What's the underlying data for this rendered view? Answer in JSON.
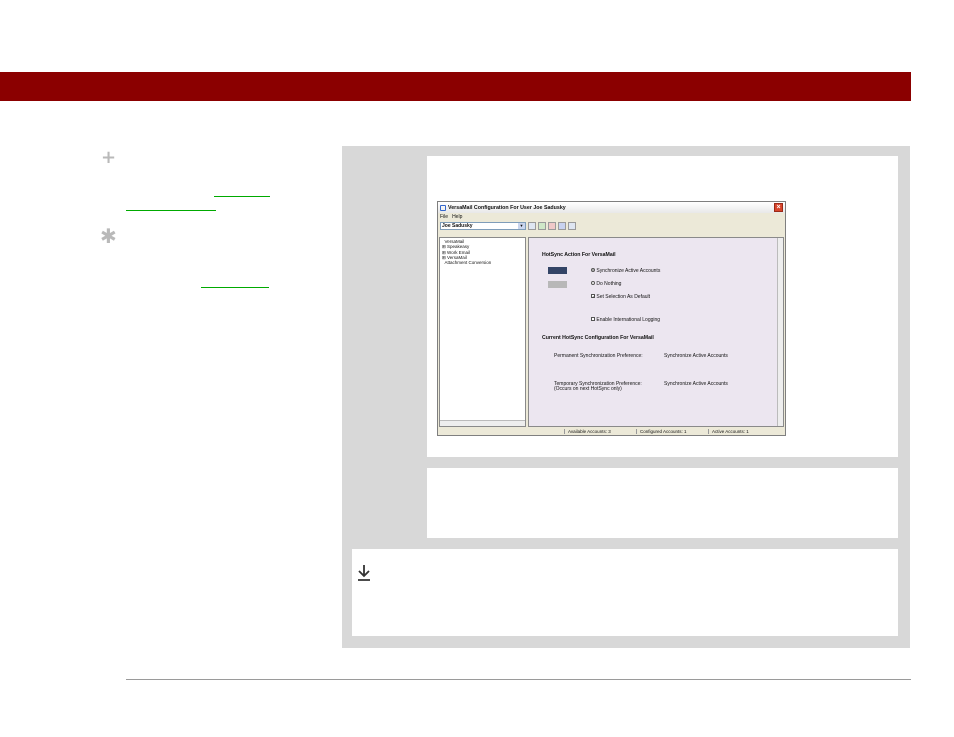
{
  "window": {
    "title": "VersaMail Configuration For User Joe Sadusky",
    "menu": [
      "File",
      "Help"
    ],
    "user_select": "Joe Sadusky",
    "tree": [
      "VersaMail",
      "Speakeasy",
      "Work Email",
      "VersaMail",
      "Attachment Conversion"
    ],
    "section_hotsync_title": "HotSync Action For VersaMail",
    "options": {
      "sync_active": "Synchronize Active Accounts",
      "do_nothing": "Do Nothing",
      "set_default": "Set Selection As Default",
      "intl_logging": "Enable International Logging"
    },
    "section_config_title": "Current HotSync Configuration For VersaMail",
    "config": {
      "permanent_label": "Permanent Synchronization Preference:",
      "permanent_value": "Synchronize Active Accounts",
      "temporary_label": "Temporary Synchronization Preference:",
      "temporary_note": "(Occurs on next HotSync only)",
      "temporary_value": "Synchronize Active Accounts"
    },
    "status": {
      "available": "Available Accounts: 3",
      "configured": "Configured Accounts: 1",
      "active": "Active Accounts: 1"
    }
  },
  "colors": {
    "header_bar": "#8b0000",
    "panel_bg": "#d8d8d8",
    "link_underline": "#00aa00"
  }
}
